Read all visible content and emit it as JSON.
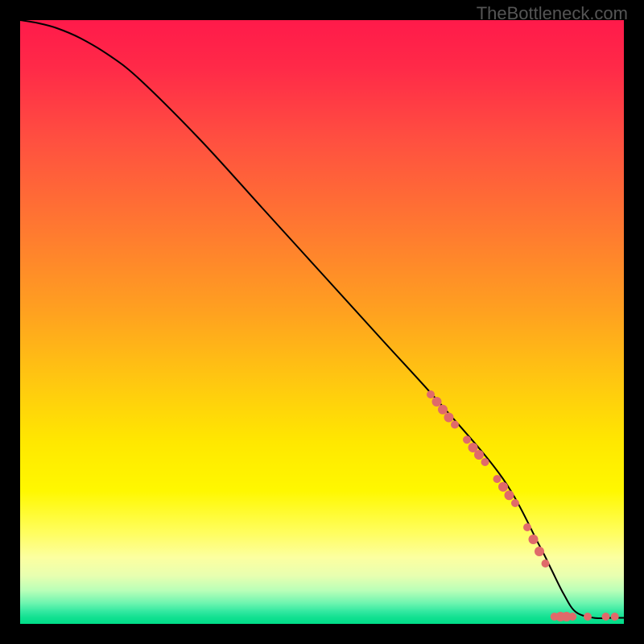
{
  "watermark": "TheBottleneck.com",
  "chart_data": {
    "type": "line",
    "title": "",
    "xlabel": "",
    "ylabel": "",
    "xlim": [
      0,
      100
    ],
    "ylim": [
      0,
      100
    ],
    "grid": false,
    "series": [
      {
        "name": "curve",
        "x": [
          0,
          3,
          6,
          10,
          15,
          20,
          30,
          40,
          50,
          60,
          70,
          80,
          86,
          88,
          90,
          92,
          95,
          98,
          100
        ],
        "y": [
          100,
          99.5,
          98.7,
          97,
          94,
          90,
          80,
          69,
          58,
          47,
          36,
          24,
          13,
          9,
          5,
          2,
          1,
          1,
          1
        ],
        "color": "#000000"
      }
    ],
    "markers": [
      {
        "x": 68,
        "y": 38,
        "r": 5
      },
      {
        "x": 69,
        "y": 36.8,
        "r": 6
      },
      {
        "x": 70,
        "y": 35.5,
        "r": 6
      },
      {
        "x": 71,
        "y": 34.2,
        "r": 6
      },
      {
        "x": 72,
        "y": 33,
        "r": 5
      },
      {
        "x": 74,
        "y": 30.5,
        "r": 5
      },
      {
        "x": 75,
        "y": 29.2,
        "r": 6
      },
      {
        "x": 76,
        "y": 28,
        "r": 6
      },
      {
        "x": 77,
        "y": 26.8,
        "r": 5
      },
      {
        "x": 79,
        "y": 24,
        "r": 5
      },
      {
        "x": 80,
        "y": 22.7,
        "r": 6
      },
      {
        "x": 81,
        "y": 21.3,
        "r": 6
      },
      {
        "x": 82,
        "y": 20,
        "r": 5
      },
      {
        "x": 84,
        "y": 16,
        "r": 5
      },
      {
        "x": 85,
        "y": 14,
        "r": 6
      },
      {
        "x": 86,
        "y": 12,
        "r": 6
      },
      {
        "x": 87,
        "y": 10,
        "r": 5
      },
      {
        "x": 88.5,
        "y": 1.2,
        "r": 5
      },
      {
        "x": 89.5,
        "y": 1.2,
        "r": 6
      },
      {
        "x": 90.5,
        "y": 1.2,
        "r": 6
      },
      {
        "x": 91.5,
        "y": 1.2,
        "r": 5
      },
      {
        "x": 94,
        "y": 1.2,
        "r": 5
      },
      {
        "x": 97,
        "y": 1.2,
        "r": 5
      },
      {
        "x": 98.5,
        "y": 1.2,
        "r": 5
      }
    ],
    "marker_color": "#e06a6a"
  }
}
